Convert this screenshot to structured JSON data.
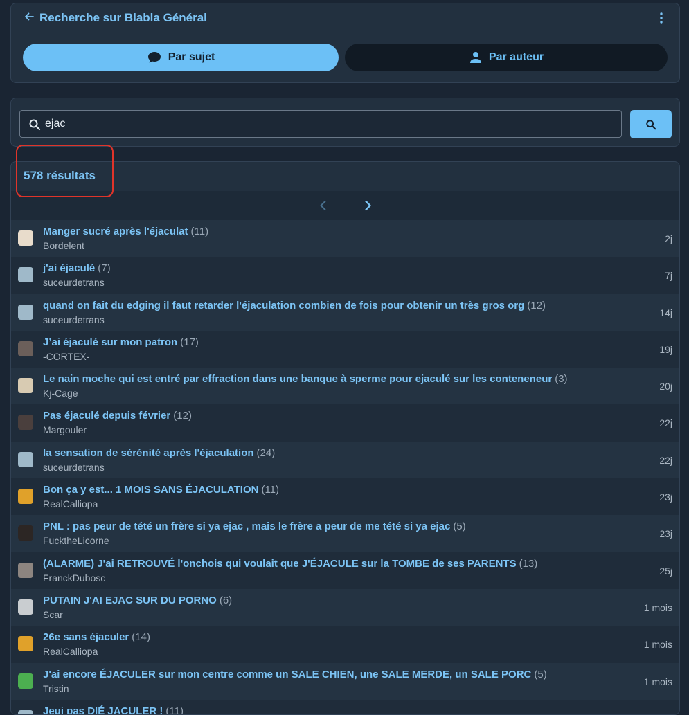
{
  "header": {
    "title": "Recherche sur Blabla Général",
    "tabs": [
      {
        "label": "Par sujet",
        "icon": "chat-bubble-icon",
        "active": true
      },
      {
        "label": "Par auteur",
        "icon": "person-icon",
        "active": false
      }
    ]
  },
  "search": {
    "value": "ejac",
    "icon": "search-icon"
  },
  "results": {
    "count_label": "578 résultats",
    "topics": [
      {
        "title": "Manger sucré après l'éjaculat",
        "count": "(11)",
        "author": "Bordelent",
        "time": "2j",
        "avatar_color": "#e8dccb"
      },
      {
        "title": "j'ai éjaculé",
        "count": "(7)",
        "author": "suceurdetrans",
        "time": "7j",
        "avatar_color": "#9fb9c9"
      },
      {
        "title": "quand on fait du edging il faut retarder l'éjaculation combien de fois pour obtenir un très gros org",
        "count": "(12)",
        "author": "suceurdetrans",
        "time": "14j",
        "avatar_color": "#9fb9c9"
      },
      {
        "title": "J’ai éjaculé sur mon patron",
        "count": "(17)",
        "author": "-CORTEX-",
        "time": "19j",
        "avatar_color": "#6b5f5a"
      },
      {
        "title": "Le nain moche qui est entré par effraction dans une banque à sperme pour ejaculé sur les conteneneur",
        "count": "(3)",
        "author": "Kj-Cage",
        "time": "20j",
        "avatar_color": "#d8cbb2"
      },
      {
        "title": "Pas éjaculé depuis février",
        "count": "(12)",
        "author": "Margouler",
        "time": "22j",
        "avatar_color": "#4a3f3d"
      },
      {
        "title": "la sensation de sérénité après l'éjaculation",
        "count": "(24)",
        "author": "suceurdetrans",
        "time": "22j",
        "avatar_color": "#9fb9c9"
      },
      {
        "title": "Bon ça y est... 1 MOIS SANS ÉJACULATION",
        "count": "(11)",
        "author": "RealCalliopa",
        "time": "23j",
        "avatar_color": "#e0a12a"
      },
      {
        "title": "PNL : pas peur de tété un frère si ya ejac , mais le frère a peur de me tété si ya ejac",
        "count": "(5)",
        "author": "FucktheLicorne",
        "time": "23j",
        "avatar_color": "#2c2624"
      },
      {
        "title": "(ALARME) J'ai RETROUVÉ l'onchois qui voulait que J'ÉJACULE sur la TOMBE de ses PARENTS",
        "count": "(13)",
        "author": "FranckDubosc",
        "time": "25j",
        "avatar_color": "#8d8580"
      },
      {
        "title": "PUTAIN J'AI EJAC SUR DU PORNO",
        "count": "(6)",
        "author": "Scar",
        "time": "1 mois",
        "avatar_color": "#c9cdd0"
      },
      {
        "title": "26e sans éjaculer",
        "count": "(14)",
        "author": "RealCalliopa",
        "time": "1 mois",
        "avatar_color": "#e0a12a"
      },
      {
        "title": "J'ai encore ÉJACULER sur mon centre comme un SALE CHIEN, une SALE MERDE, un SALE PORC",
        "count": "(5)",
        "author": "Tristin",
        "time": "1 mois",
        "avatar_color": "#4caf50"
      },
      {
        "title": "Jeui pas DIÉ JACULER !",
        "count": "(11)",
        "author": "",
        "time": "",
        "avatar_color": "#9fb9c9"
      }
    ]
  }
}
